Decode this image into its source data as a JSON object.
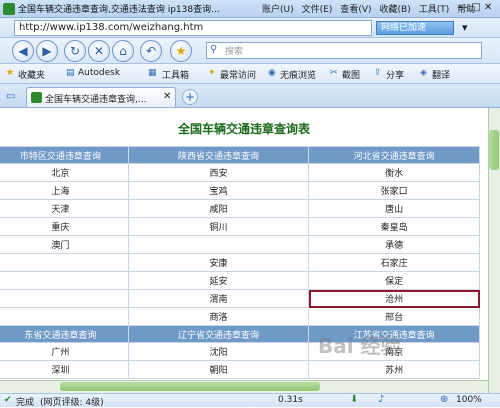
{
  "window": {
    "title": "全国车辆交通违章查询,交通违法查询 ip138查询...",
    "menu": [
      "账户(U)",
      "文件(E)",
      "查看(V)",
      "收藏(B)",
      "工具(T)",
      "帮助"
    ],
    "controls": [
      "—",
      "□",
      "✕"
    ]
  },
  "address": {
    "url": "http://www.ip138.com/weizhang.htm",
    "speed_label": "网络已加速"
  },
  "search": {
    "placeholder": "搜索"
  },
  "favorites": {
    "items": [
      "收藏夹",
      "Autodesk",
      "工具箱",
      "最常访问",
      "无痕浏览",
      "截图",
      "分享",
      "翻译"
    ]
  },
  "tab": {
    "label": "全国车辆交通违章查询,..."
  },
  "page": {
    "title": "全国车辆交通违章查询表"
  },
  "table": {
    "headers": [
      "市特区交通违章查询",
      "陕西省交通违章查询",
      "河北省交通违章查询"
    ],
    "rows": [
      [
        "北京",
        "西安",
        "衡水"
      ],
      [
        "上海",
        "宝鸡",
        "张家口"
      ],
      [
        "天津",
        "咸阳",
        "唐山"
      ],
      [
        "重庆",
        "铜川",
        "秦皇岛"
      ],
      [
        "澳门",
        "",
        "承德"
      ],
      [
        "",
        "安康",
        "石家庄"
      ],
      [
        "",
        "延安",
        "保定"
      ],
      [
        "",
        "渭南",
        "沧州"
      ],
      [
        "",
        "商洛",
        "邢台"
      ]
    ],
    "headers2": [
      "东省交通违章查询",
      "辽宁省交通违章查询",
      "江苏省交通违章查询"
    ],
    "rows2": [
      [
        "广州",
        "沈阳",
        "南京"
      ],
      [
        "深圳",
        "朝阳",
        "苏州"
      ]
    ]
  },
  "status": {
    "left": "完成",
    "rating": "(网页评级: 4级)",
    "time": "0.31s",
    "zoom": "100%"
  },
  "watermark": "Bai 经验",
  "colors": {
    "header_bg": "#6f9ac8",
    "title_green": "#1c6b1c",
    "highlight": "#8b1a2e"
  }
}
